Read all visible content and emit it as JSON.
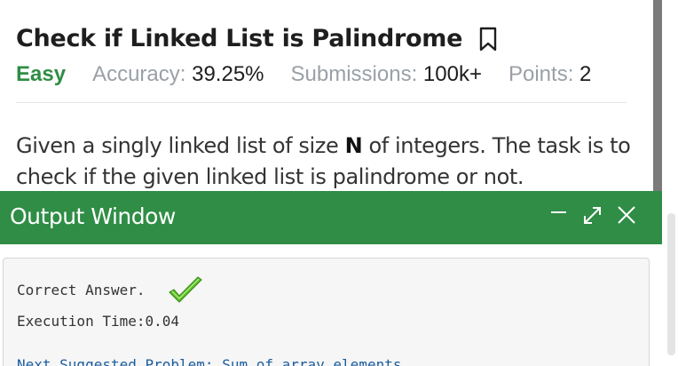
{
  "problem": {
    "title": "Check if Linked List is Palindrome",
    "difficulty": "Easy",
    "accuracy_label": "Accuracy:",
    "accuracy_value": "39.25%",
    "submissions_label": "Submissions:",
    "submissions_value": "100k+",
    "points_label": "Points:",
    "points_value": "2",
    "statement_part1": "Given a singly linked list of size ",
    "statement_bold": "N",
    "statement_part2": " of integers. The task is to check if the given linked list is palindrome or not."
  },
  "output_window": {
    "title": "Output Window",
    "line1": "Correct Answer.",
    "line2": "Execution Time:0.04",
    "line3": "Next Suggested Problem: Sum of array  elements"
  },
  "colors": {
    "brand_green": "#2f8d46",
    "title_text": "#1e1e1e",
    "muted_text": "#9aa0a6"
  },
  "icons": {
    "bookmark": "bookmark-icon",
    "minimize": "minimize-icon",
    "maximize": "expand-icon",
    "close": "close-icon",
    "success": "checkmark-icon"
  }
}
